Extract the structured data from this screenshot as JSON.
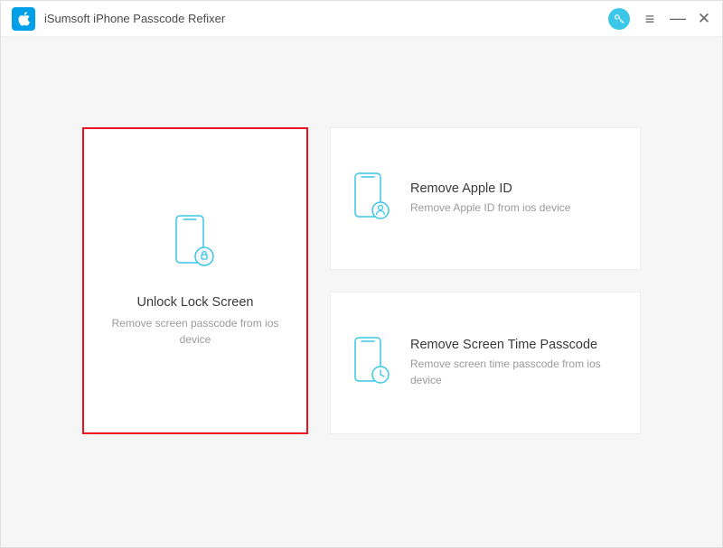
{
  "app": {
    "title": "iSumsoft iPhone Passcode Refixer"
  },
  "cards": {
    "unlock": {
      "title": "Unlock Lock Screen",
      "desc": "Remove screen passcode from ios device"
    },
    "appleId": {
      "title": "Remove Apple ID",
      "desc": "Remove Apple ID from ios device"
    },
    "screenTime": {
      "title": "Remove Screen Time Passcode",
      "desc": "Remove screen time passcode from ios device"
    }
  }
}
